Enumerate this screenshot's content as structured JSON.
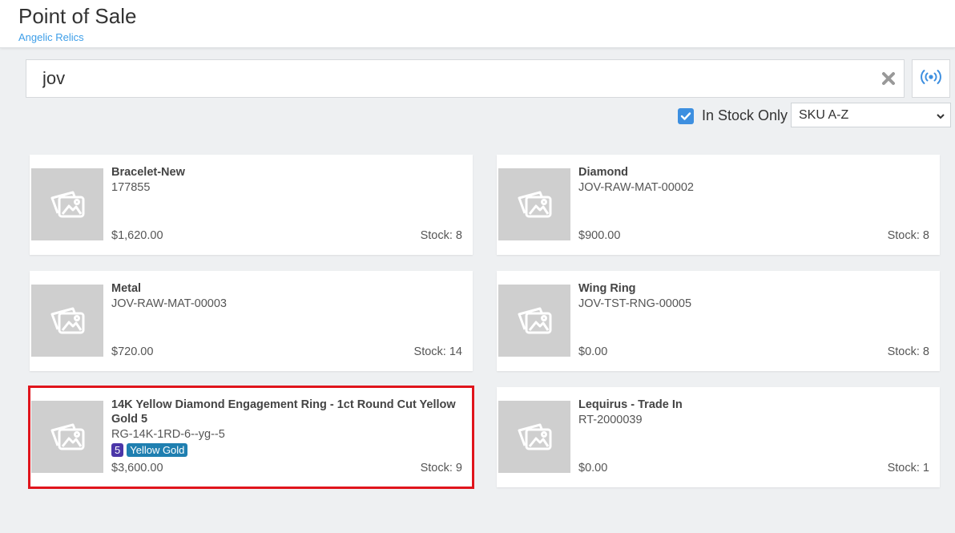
{
  "header": {
    "title": "Point of Sale",
    "subtitle": "Angelic Relics"
  },
  "search": {
    "value": "jov"
  },
  "filters": {
    "in_stock_label": "In Stock Only",
    "in_stock_checked": true,
    "sort_value": "SKU A-Z"
  },
  "products": [
    {
      "name": "Bracelet-New",
      "sku": "177855",
      "price": "$1,620.00",
      "stock": "Stock: 8"
    },
    {
      "name": "Diamond",
      "sku": "JOV-RAW-MAT-00002",
      "price": "$900.00",
      "stock": "Stock: 8"
    },
    {
      "name": "Metal",
      "sku": "JOV-RAW-MAT-00003",
      "price": "$720.00",
      "stock": "Stock: 14"
    },
    {
      "name": "Wing Ring",
      "sku": "JOV-TST-RNG-00005",
      "price": "$0.00",
      "stock": "Stock: 8"
    },
    {
      "name": "14K Yellow Diamond Engagement Ring - 1ct Round Cut Yellow Gold 5",
      "sku": "RG-14K-1RD-6--yg--5",
      "badges": [
        "5",
        "Yellow Gold"
      ],
      "price": "$3,600.00",
      "stock": "Stock: 9",
      "selected": true
    },
    {
      "name": "Lequirus - Trade In",
      "sku": "RT-2000039",
      "price": "$0.00",
      "stock": "Stock: 1"
    }
  ],
  "colors": {
    "accent": "#3d9ee8",
    "checkbox": "#3d8fe0",
    "selected_outline": "#e0141c",
    "badge_size": "#4b36a8",
    "badge_metal": "#1f7fb0"
  },
  "icons": {
    "clear": "close-x-icon",
    "scan": "rfid-broadcast-icon",
    "thumb": "image-placeholder-icon"
  }
}
